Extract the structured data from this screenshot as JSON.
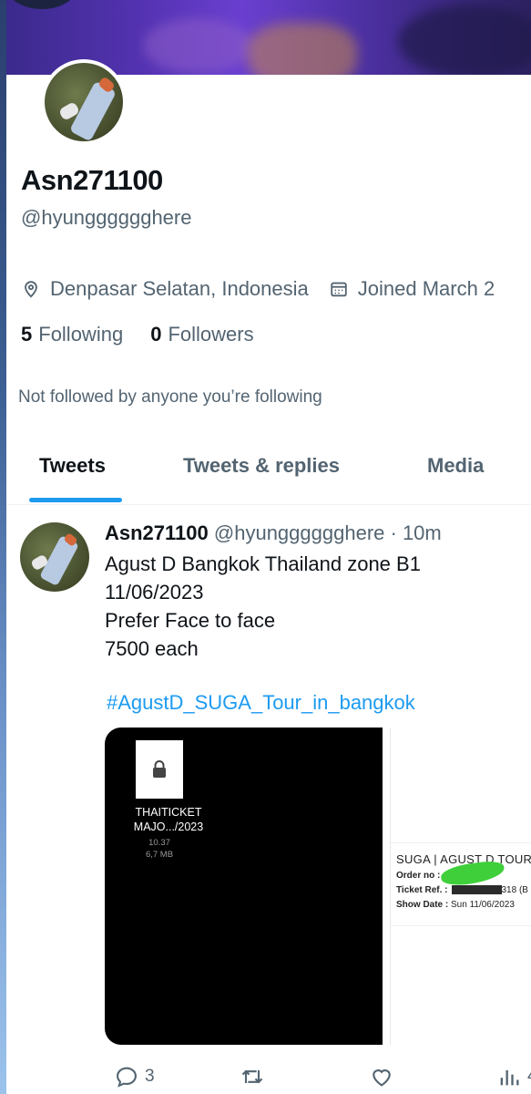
{
  "profile": {
    "display_name": "Asn271100",
    "handle": "@hyungggggghere",
    "location": "Denpasar Selatan, Indonesia",
    "joined": "Joined March 2",
    "following_count": "5",
    "following_label": "Following",
    "followers_count": "0",
    "followers_label": "Followers",
    "not_followed_text": "Not followed by anyone you’re following"
  },
  "tabs": [
    {
      "label": "Tweets",
      "active": true
    },
    {
      "label": "Tweets & replies",
      "active": false
    },
    {
      "label": "Media",
      "active": false
    }
  ],
  "tweet": {
    "author_name": "Asn271100",
    "author_handle": "@hyungggggghere",
    "time": "· 10m",
    "lines": [
      "Agust D Bangkok Thailand zone B1",
      "11/06/2023",
      "Prefer Face to face",
      "7500 each"
    ],
    "hashtag": "#AgustD_SUGA_Tour_in_bangkok",
    "media": {
      "file_name": "THAITICKET MAJO.../2023",
      "file_time": "10.37",
      "file_size": "6,7 MB",
      "ticket_title": "SUGA | AGUST D TOUR",
      "order_label": "Order no :",
      "ticket_ref_label": "Ticket Ref. :",
      "ticket_ref_value": "318 (B",
      "show_date_label": "Show Date :",
      "show_date_value": "Sun 11/06/2023"
    },
    "actions": {
      "reply_count": "3",
      "retweet_count": "",
      "like_count": "",
      "views_count": "4"
    }
  },
  "colors": {
    "accent": "#1d9bf0",
    "secondary_text": "#536471",
    "primary_text": "#0f1419"
  }
}
